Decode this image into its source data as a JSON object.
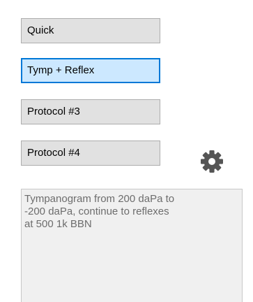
{
  "protocols": {
    "buttons": [
      {
        "label": "Quick"
      },
      {
        "label": "Tymp + Reflex"
      },
      {
        "label": "Protocol #3"
      },
      {
        "label": "Protocol #4"
      }
    ],
    "selected_label": "Tymp + Reflex"
  },
  "settings": {
    "icon": "gear-icon",
    "color": "#555555"
  },
  "description": {
    "text": "Tympanogram from 200 daPa to\n-200 daPa, continue to reflexes\nat 500 1k BBN"
  },
  "colors": {
    "button_bg": "#e1e1e1",
    "selected_bg": "#cce8ff",
    "selected_border": "#0078d7",
    "description_text": "#6d6d6d"
  }
}
